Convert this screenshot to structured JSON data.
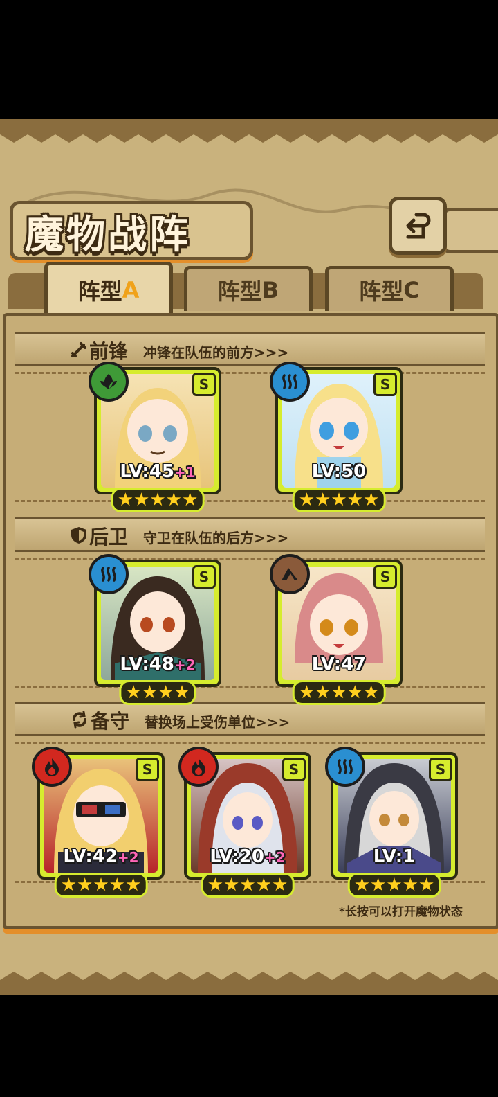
{
  "title": "魔物战阵",
  "tabs": [
    {
      "label": "阵型",
      "letter": "A",
      "active": true
    },
    {
      "label": "阵型",
      "letter": "B",
      "active": false
    },
    {
      "label": "阵型",
      "letter": "C",
      "active": false
    }
  ],
  "sections": {
    "front": {
      "title": "前锋",
      "desc": "冲锋在队伍的前方>>>"
    },
    "back": {
      "title": "后卫",
      "desc": "守卫在队伍的后方>>>"
    },
    "reserve": {
      "title": "备守",
      "desc": "替换场上受伤单位>>>"
    }
  },
  "cards": [
    {
      "element": "nature",
      "rank": "S",
      "lv": "LV:45",
      "plus": "+1",
      "stars": 5
    },
    {
      "element": "water",
      "rank": "S",
      "lv": "LV:50",
      "plus": "",
      "stars": 5
    },
    {
      "element": "water",
      "rank": "S",
      "lv": "LV:48",
      "plus": "+2",
      "stars": 4
    },
    {
      "element": "earth",
      "rank": "S",
      "lv": "LV:47",
      "plus": "",
      "stars": 5
    },
    {
      "element": "fire",
      "rank": "S",
      "lv": "LV:42",
      "plus": "+2",
      "stars": 5
    },
    {
      "element": "fire",
      "rank": "S",
      "lv": "LV:20",
      "plus": "+2",
      "stars": 5
    },
    {
      "element": "water",
      "rank": "S",
      "lv": "LV:1",
      "plus": "",
      "stars": 5
    }
  ],
  "hint": "*长按可以打开魔物状态",
  "colors": {
    "card_frame": "#d6ec2e",
    "accent": "#e48f2a",
    "plus": "#ff66b8",
    "star": "#ffcf1e"
  }
}
